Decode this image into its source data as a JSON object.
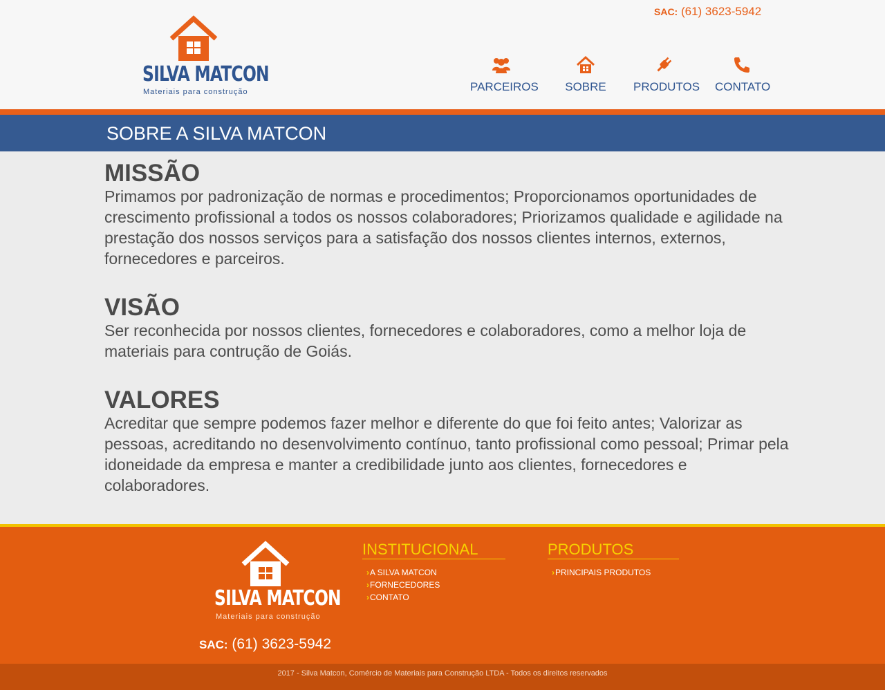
{
  "header": {
    "sac_label": "SAC:",
    "sac_phone": "(61) 3623-5942",
    "brand": "SILVA MATCON",
    "tagline": "Materiais para construção"
  },
  "nav": [
    {
      "label": "PARCEIROS",
      "icon": "users-icon"
    },
    {
      "label": "SOBRE",
      "icon": "house-icon"
    },
    {
      "label": "PRODUTOS",
      "icon": "plug-icon"
    },
    {
      "label": "CONTATO",
      "icon": "phone-icon"
    }
  ],
  "page_title": "SOBRE A SILVA MATCON",
  "sections": {
    "missao": {
      "heading": "MISSÃO",
      "text": "Primamos por padronização de normas e procedimentos; Proporcionamos oportunidades de crescimento profissional a todos os nossos colaboradores; Priorizamos qualidade e agilidade na prestação dos nossos serviços para a satisfação dos nossos clientes internos, externos, fornecedores e parceiros."
    },
    "visao": {
      "heading": "VISÃO",
      "text": "Ser reconhecida por nossos clientes, fornecedores e colaboradores, como a melhor loja de materiais para contrução de Goiás."
    },
    "valores": {
      "heading": "VALORES",
      "text": "Acreditar que sempre podemos fazer melhor e diferente do que foi feito antes; Valorizar as pessoas, acreditando no desenvolvimento contínuo, tanto profissional como pessoal; Primar pela idoneidade da empresa e manter a credibilidade junto aos clientes, fornecedores e colaboradores."
    }
  },
  "footer": {
    "brand": "SILVA MATCON",
    "tagline": "Materiais para construção",
    "sac_label": "SAC:",
    "sac_phone": "(61) 3623-5942",
    "institucional": {
      "title": "INSTITUCIONAL",
      "links": [
        "A SILVA MATCON",
        "FORNECEDORES",
        "CONTATO"
      ]
    },
    "produtos": {
      "title": "PRODUTOS",
      "links": [
        "PRINCIPAIS PRODUTOS"
      ]
    },
    "copyright": "2017 - Silva Matcon, Comércio de Materiais para Construção LTDA - Todos os direitos reservados"
  },
  "colors": {
    "orange": "#e8601a",
    "blue": "#355a91",
    "yellow": "#f7d100"
  }
}
